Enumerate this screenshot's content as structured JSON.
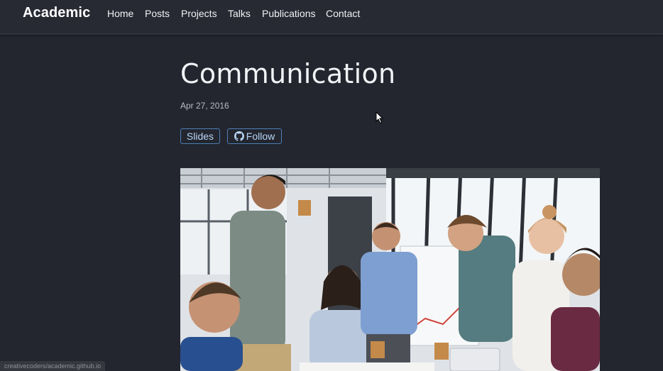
{
  "navbar": {
    "brand": "Academic",
    "links": [
      "Home",
      "Posts",
      "Projects",
      "Talks",
      "Publications",
      "Contact"
    ]
  },
  "post": {
    "title": "Communication",
    "date": "Apr 27, 2016",
    "buttons": {
      "slides": "Slides",
      "follow": "Follow"
    },
    "image_alt": "people-meeting-photo"
  },
  "status_bar": {
    "url": "creativecoders/academic.github.io"
  },
  "colors": {
    "background": "#23262f",
    "navbar": "#272a33",
    "button_border": "#4d7fb5",
    "button_text": "#b9d6f6"
  }
}
